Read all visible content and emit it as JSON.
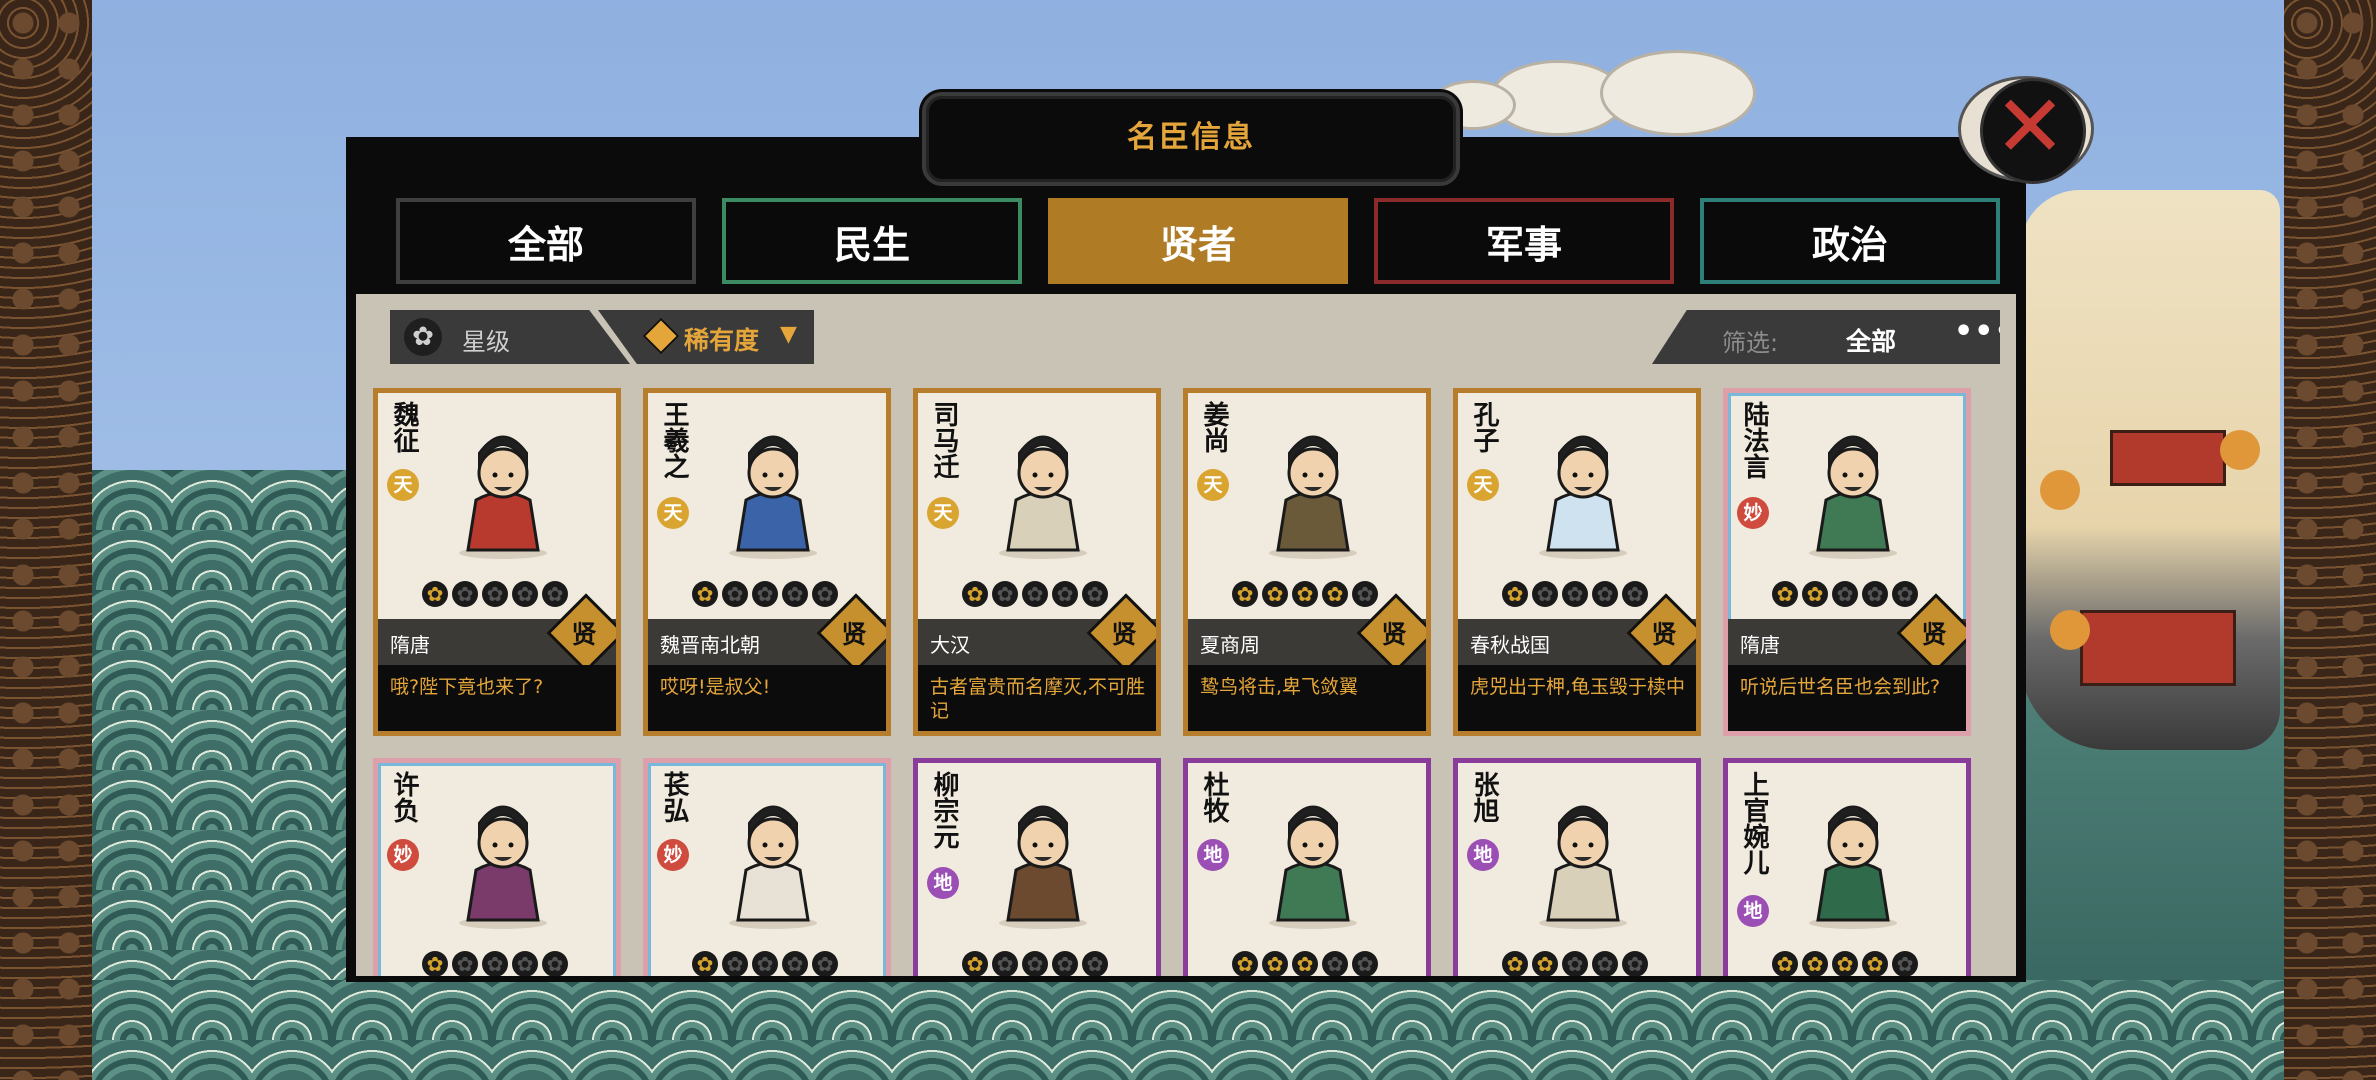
{
  "header": {
    "title": "名臣信息"
  },
  "tabs": [
    {
      "label": "全部"
    },
    {
      "label": "民生"
    },
    {
      "label": "贤者"
    },
    {
      "label": "军事"
    },
    {
      "label": "政治"
    }
  ],
  "active_tab": "贤者",
  "sort": {
    "star_label": "星级",
    "rarity_label": "稀有度"
  },
  "filter": {
    "label": "筛选:",
    "value": "全部",
    "more": "•••"
  },
  "close_icon": "close-x-icon",
  "colors": {
    "accent": "#e4a53a",
    "active_tab": "#b07b25",
    "tier_tian": "#d9a530",
    "tier_miao": "#cf4b3d",
    "tier_di": "#9b4fb5"
  },
  "cards": [
    {
      "name": "魏征",
      "tier": "天",
      "stars": 1,
      "dynasty": "隋唐",
      "badge": "贤",
      "quote": "哦?陛下竟也来了?"
    },
    {
      "name": "王羲之",
      "tier": "天",
      "stars": 1,
      "dynasty": "魏晋南北朝",
      "badge": "贤",
      "quote": "哎呀!是叔父!"
    },
    {
      "name": "司马迁",
      "tier": "天",
      "stars": 1,
      "dynasty": "大汉",
      "badge": "贤",
      "quote": "古者富贵而名摩灭,不可胜记"
    },
    {
      "name": "姜尚",
      "tier": "天",
      "stars": 4,
      "dynasty": "夏商周",
      "badge": "贤",
      "quote": "鸷鸟将击,卑飞敛翼"
    },
    {
      "name": "孔子",
      "tier": "天",
      "stars": 1,
      "dynasty": "春秋战国",
      "badge": "贤",
      "quote": "虎兕出于柙,龟玉毁于椟中"
    },
    {
      "name": "陆法言",
      "tier": "妙",
      "stars": 2,
      "dynasty": "隋唐",
      "badge": "贤",
      "quote": "听说后世名臣也会到此?"
    },
    {
      "name": "许负",
      "tier": "妙",
      "stars": 1,
      "dynasty": "",
      "badge": "",
      "quote": ""
    },
    {
      "name": "苌弘",
      "tier": "妙",
      "stars": 1,
      "dynasty": "",
      "badge": "",
      "quote": ""
    },
    {
      "name": "柳宗元",
      "tier": "地",
      "stars": 1,
      "dynasty": "",
      "badge": "",
      "quote": ""
    },
    {
      "name": "杜牧",
      "tier": "地",
      "stars": 3,
      "dynasty": "",
      "badge": "",
      "quote": ""
    },
    {
      "name": "张旭",
      "tier": "地",
      "stars": 2,
      "dynasty": "",
      "badge": "",
      "quote": ""
    },
    {
      "name": "上官婉儿",
      "tier": "地",
      "stars": 4,
      "dynasty": "",
      "badge": "",
      "quote": ""
    }
  ]
}
